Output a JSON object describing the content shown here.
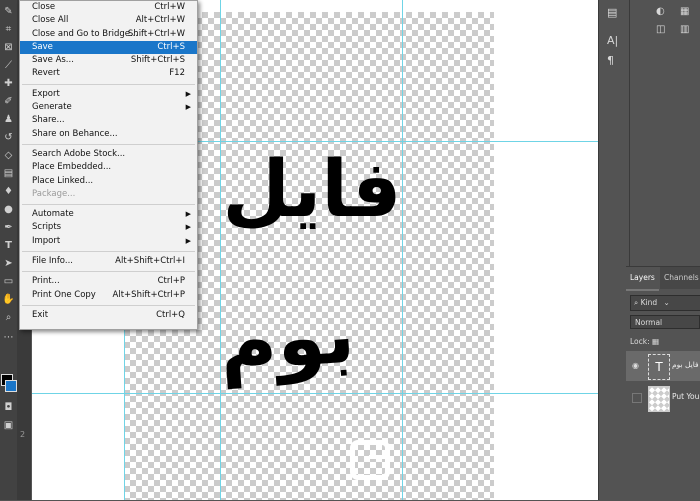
{
  "file_menu": {
    "items": [
      {
        "label": "Close",
        "shortcut": "Ctrl+W"
      },
      {
        "label": "Close All",
        "shortcut": "Alt+Ctrl+W"
      },
      {
        "label": "Close and Go to Bridge...",
        "shortcut": "Shift+Ctrl+W"
      },
      {
        "label": "Save",
        "shortcut": "Ctrl+S"
      },
      {
        "label": "Save As...",
        "shortcut": "Shift+Ctrl+S"
      },
      {
        "label": "Revert",
        "shortcut": "F12"
      },
      {
        "label": "Export",
        "submenu": true
      },
      {
        "label": "Generate",
        "submenu": true
      },
      {
        "label": "Share..."
      },
      {
        "label": "Share on Behance..."
      },
      {
        "label": "Search Adobe Stock..."
      },
      {
        "label": "Place Embedded..."
      },
      {
        "label": "Place Linked..."
      },
      {
        "label": "Package..."
      },
      {
        "label": "Automate",
        "submenu": true
      },
      {
        "label": "Scripts",
        "submenu": true
      },
      {
        "label": "Import",
        "submenu": true
      },
      {
        "label": "File Info...",
        "shortcut": "Alt+Shift+Ctrl+I"
      },
      {
        "label": "Print...",
        "shortcut": "Ctrl+P"
      },
      {
        "label": "Print One Copy",
        "shortcut": "Alt+Shift+Ctrl+P"
      },
      {
        "label": "Exit",
        "shortcut": "Ctrl+Q"
      }
    ],
    "selected": "Save",
    "disabled": "Package..."
  },
  "canvas": {
    "text_line1": "فایل",
    "text_line2": "بوم"
  },
  "ruler": {
    "mark": "2"
  },
  "layers_panel": {
    "tabs": [
      "Layers",
      "Channels"
    ],
    "filter_label": "Kind",
    "blend_mode": "Normal",
    "lock_label": "Lock:",
    "layers": [
      {
        "name": "فایل بوم",
        "type": "text",
        "thumb_glyph": "T"
      },
      {
        "name": "Put Your",
        "type": "image"
      }
    ]
  },
  "colors": {
    "menu_highlight": "#1a76c9",
    "guide": "#6fd4e6",
    "panel_bg": "#535353"
  },
  "icons": {
    "toolbar": [
      "brush-icon",
      "crop-icon",
      "frame-icon",
      "eyedropper-icon",
      "healing-icon",
      "brush-tool-icon",
      "stamp-icon",
      "history-brush-icon",
      "eraser-icon",
      "gradient-icon",
      "blur-icon",
      "dodge-icon",
      "pen-icon",
      "type-icon",
      "path-select-icon",
      "rectangle-icon",
      "hand-icon",
      "zoom-icon",
      "more-icon"
    ],
    "dock": [
      "history-icon",
      "character-icon",
      "paragraph-icon",
      "adjustments-icon",
      "swatches-icon"
    ]
  }
}
